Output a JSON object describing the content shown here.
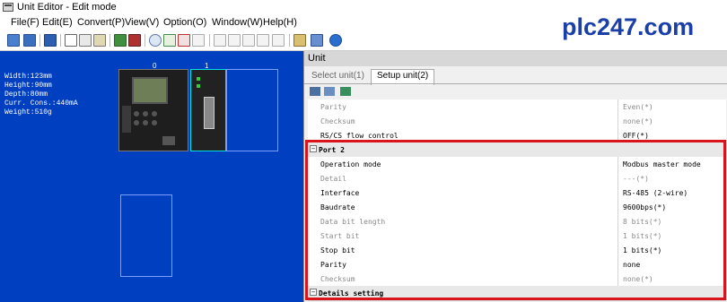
{
  "window": {
    "title": "Unit Editor - Edit mode"
  },
  "menu": [
    "File(F)",
    "Edit(E)",
    "Convert(P)",
    "View(V)",
    "Option(O)",
    "Window(W)",
    "Help(H)"
  ],
  "watermark": "plc247.com",
  "canvas": {
    "specs": [
      "Width:123mm",
      "Height:90mm",
      "Depth:80mm",
      "Curr. Cons.:440mA",
      "Weight:510g"
    ],
    "slot_labels": [
      "0",
      "1"
    ],
    "background_color": "#003fbf"
  },
  "unit_panel": {
    "title": "Unit",
    "tabs": [
      {
        "label": "Select unit(1)",
        "selected": false
      },
      {
        "label": "Setup unit(2)",
        "selected": true
      }
    ],
    "rows": [
      {
        "name": "Parity",
        "value": "Even(*)",
        "style": "dis"
      },
      {
        "name": "Checksum",
        "value": "none(*)",
        "style": "dis"
      },
      {
        "name": "RS/CS flow control",
        "value": "OFF(*)",
        "style": "norm"
      },
      {
        "name": "Port 2",
        "value": "",
        "style": "grp"
      },
      {
        "name": "Operation mode",
        "value": "Modbus master mode",
        "style": "norm"
      },
      {
        "name": "Detail",
        "value": "---(*)",
        "style": "dis"
      },
      {
        "name": "Interface",
        "value": "RS-485 (2-wire)",
        "style": "norm"
      },
      {
        "name": "Baudrate",
        "value": "9600bps(*)",
        "style": "norm"
      },
      {
        "name": "Data bit length",
        "value": "8 bits(*)",
        "style": "dis"
      },
      {
        "name": "Start bit",
        "value": "1 bits(*)",
        "style": "dis"
      },
      {
        "name": "Stop bit",
        "value": "1 bits(*)",
        "style": "norm"
      },
      {
        "name": "Parity",
        "value": "none",
        "style": "norm"
      },
      {
        "name": "Checksum",
        "value": "none(*)",
        "style": "dis"
      },
      {
        "name": "Details setting",
        "value": "",
        "style": "grp"
      }
    ]
  },
  "highlight_color": "#d9141b"
}
